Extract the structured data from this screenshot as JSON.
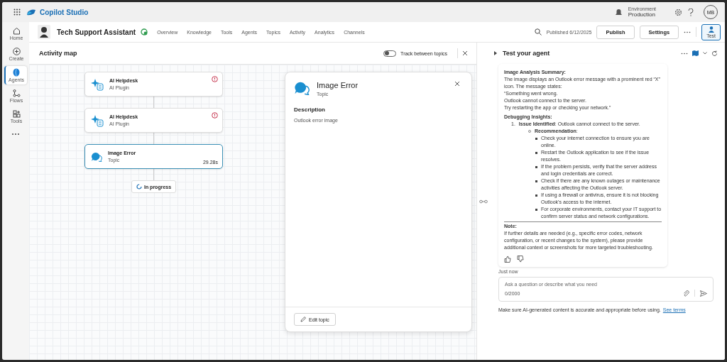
{
  "topbar": {
    "app_name": "Copilot Studio",
    "environment_label": "Environment",
    "environment_name": "Production",
    "avatar_initials": "MB"
  },
  "rail": [
    {
      "kind": "home",
      "label": "Home",
      "selected": false
    },
    {
      "kind": "create",
      "label": "Create",
      "selected": false
    },
    {
      "kind": "agents",
      "label": "Agents",
      "selected": true
    },
    {
      "kind": "flows",
      "label": "Flows",
      "selected": false
    },
    {
      "kind": "tools",
      "label": "Tools",
      "selected": false
    }
  ],
  "agent": {
    "name": "Tech Support Assistant",
    "nav": [
      "Overview",
      "Knowledge",
      "Tools",
      "Agents",
      "Topics",
      "Activity",
      "Analytics",
      "Channels"
    ],
    "published": "Published 6/12/2025",
    "buttons": [
      "Publish",
      "Settings"
    ],
    "test": {
      "label": "Test",
      "selected": true
    }
  },
  "activity_map": {
    "title": "Activity map",
    "toggle": {
      "label": "Track between topics",
      "on": false
    },
    "nodes": [
      {
        "kind": "plugin",
        "title": "AI Helpdesk",
        "subtitle": "AI Plugin",
        "error": true,
        "selected": false
      },
      {
        "kind": "plugin",
        "title": "AI Helpdesk",
        "subtitle": "AI Plugin",
        "error": true,
        "selected": false
      },
      {
        "kind": "topic",
        "title": "Image Error",
        "subtitle": "Topic",
        "error": false,
        "selected": true,
        "duration": "29.28s"
      }
    ],
    "status": "In progress"
  },
  "detail": {
    "title": "Image Error",
    "subtitle": "Topic",
    "description_label": "Description",
    "description": "Outlook error image",
    "edit_button": "Edit topic"
  },
  "test_panel": {
    "title": "Test your agent",
    "message": {
      "heading": "Image Analysis Summary:",
      "intro": [
        "The image displays an Outlook error message with a prominent red “X” icon. The message states:",
        "“Something went wrong.",
        "Outlook cannot connect to the server.",
        "Try restarting the app or checking your network.”"
      ],
      "insights_heading": "Debugging Insights:",
      "number": "1.",
      "issue": "**Issue Identified**: Outlook cannot connect to the server.",
      "recommendation": "**Recommendation**:",
      "bullets": [
        "Check your internet connection to ensure you are online.",
        "Restart the Outlook application to see if the issue resolves.",
        "If the problem persists, verify that the server address and login credentials are correct.",
        "Check if there are any known outages or maintenance activities affecting the Outlook server.",
        "If using a firewall or antivirus, ensure it is not blocking Outlook's access to the internet.",
        "For corporate environments, contact your IT support to confirm server status and network configurations."
      ],
      "note_heading": "Note:",
      "note": "If further details are needed (e.g., specific error codes, network configuration, or recent changes to the system), please provide additional context or screenshots for more targeted troubleshooting."
    },
    "timestamp": "Just now",
    "input": {
      "placeholder": "Ask a question or describe what you need",
      "counter": "0/2000"
    },
    "disclaimer": "Make sure AI-generated content is accurate and appropriate before using.",
    "terms_link": "See terms"
  }
}
